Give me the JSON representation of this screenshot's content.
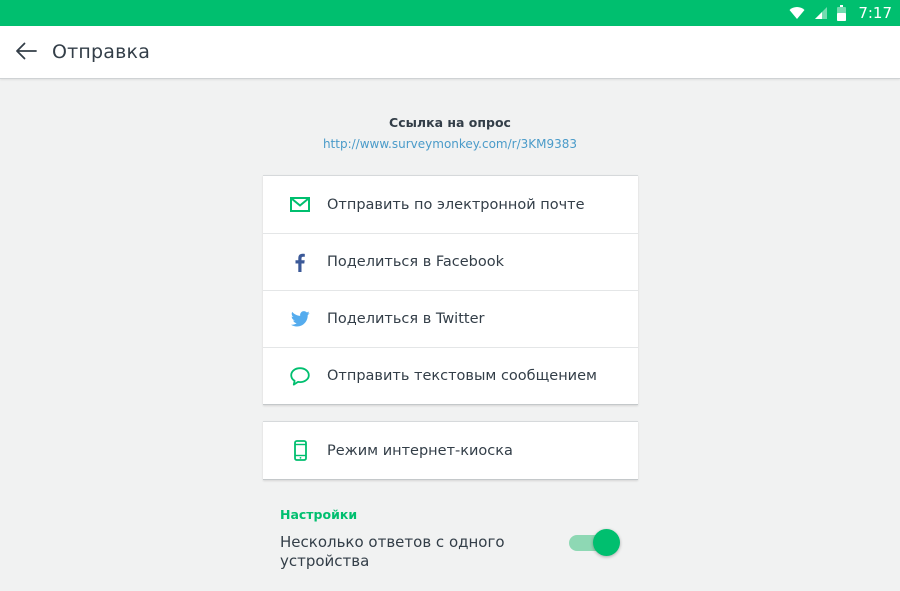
{
  "status_bar": {
    "time": "7:17",
    "icons": [
      "wifi-icon",
      "signal-icon",
      "battery-icon"
    ]
  },
  "header": {
    "title": "Отправка",
    "back_icon": "arrow-left-icon"
  },
  "survey_link": {
    "label": "Ссылка на опрос",
    "url": "http://www.surveymonkey.com/r/3KM9383"
  },
  "share_options": [
    {
      "label": "Отправить по электронной почте",
      "icon": "mail-icon"
    },
    {
      "label": "Поделиться в Facebook",
      "icon": "facebook-icon"
    },
    {
      "label": "Поделиться в Twitter",
      "icon": "twitter-icon"
    },
    {
      "label": "Отправить текстовым сообщением",
      "icon": "chat-bubble-icon"
    }
  ],
  "kiosk": {
    "label": "Режим интернет-киоска",
    "icon": "phone-icon"
  },
  "settings": {
    "title": "Настройки",
    "multiple_responses": {
      "label": "Несколько ответов с одного устройства",
      "enabled": true
    }
  },
  "colors": {
    "brand_green": "#00bf6f",
    "link_blue": "#4a9bc9",
    "facebook_blue": "#3b5998",
    "twitter_blue": "#55acee",
    "toggle_track": "#8ed8b4"
  }
}
